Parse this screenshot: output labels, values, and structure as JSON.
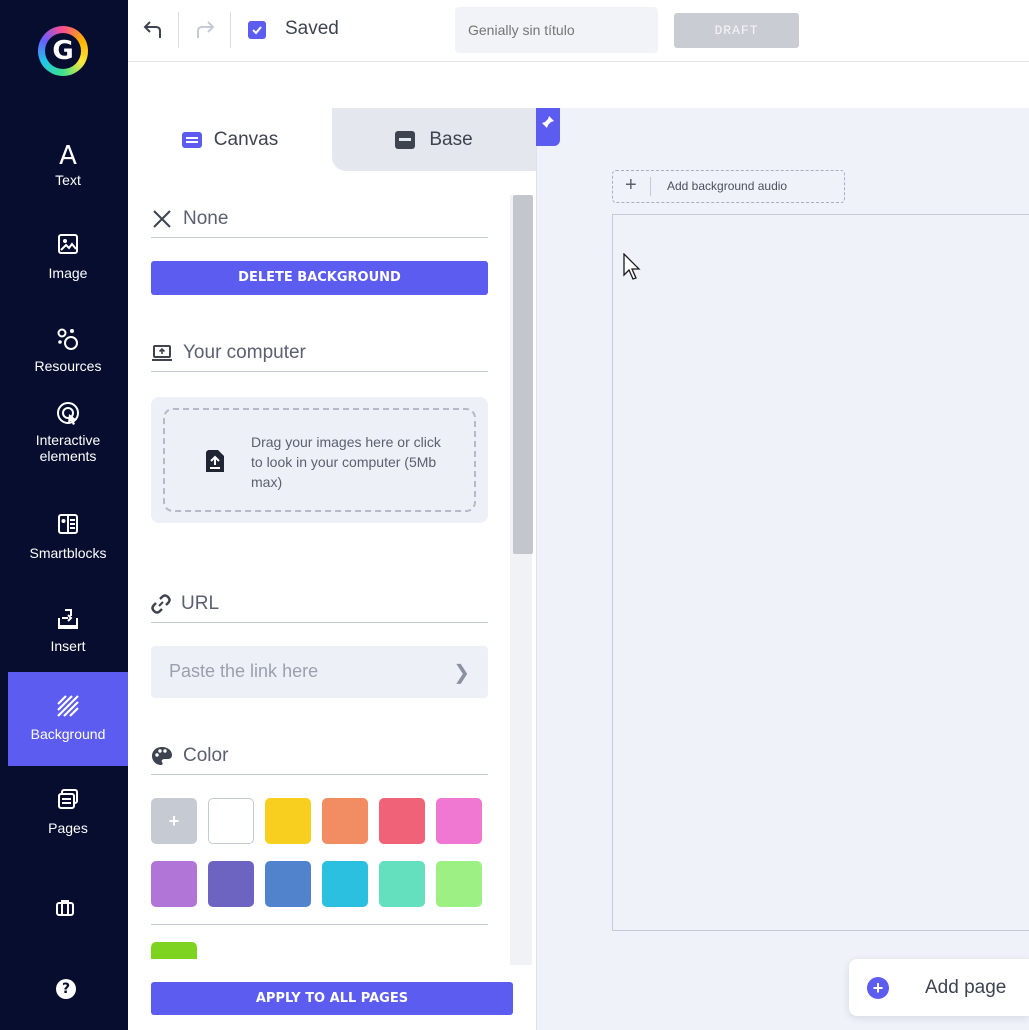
{
  "sidebar": {
    "items": [
      {
        "label": "Text",
        "icon": "text-icon"
      },
      {
        "label": "Image",
        "icon": "image-icon"
      },
      {
        "label": "Resources",
        "icon": "resources-icon"
      },
      {
        "label": "Interactive elements",
        "icon": "interactive-icon"
      },
      {
        "label": "Smartblocks",
        "icon": "smartblocks-icon"
      },
      {
        "label": "Insert",
        "icon": "insert-icon"
      },
      {
        "label": "Background",
        "icon": "background-icon",
        "active": true
      },
      {
        "label": "Pages",
        "icon": "pages-icon"
      }
    ],
    "accent": "#5c5cf0",
    "background": "#060d2e"
  },
  "toolbar": {
    "saved_label": "Saved",
    "title_placeholder": "Genially sin título",
    "draft_label": "DRAFT"
  },
  "panel": {
    "tabs": [
      {
        "label": "Canvas",
        "active": true
      },
      {
        "label": "Base",
        "active": false
      }
    ],
    "none_label": "None",
    "delete_background_label": "DELETE BACKGROUND",
    "your_computer_label": "Your computer",
    "dropzone_text": "Drag your images here or click to look in your computer (5Mb max)",
    "url_label": "URL",
    "url_placeholder": "Paste the link here",
    "color_label": "Color",
    "add_color_label": "+",
    "swatches": [
      "#ffffff",
      "#f8cf1f",
      "#f28c62",
      "#f06278",
      "#f178d2",
      "#b175d8",
      "#6d63c0",
      "#5083cc",
      "#2bbfe0",
      "#64e0bf",
      "#9df083",
      "#7ed321"
    ],
    "apply_all_label": "APPLY TO ALL PAGES"
  },
  "stage": {
    "add_audio_label": "Add background audio",
    "add_page_label": "Add page"
  }
}
